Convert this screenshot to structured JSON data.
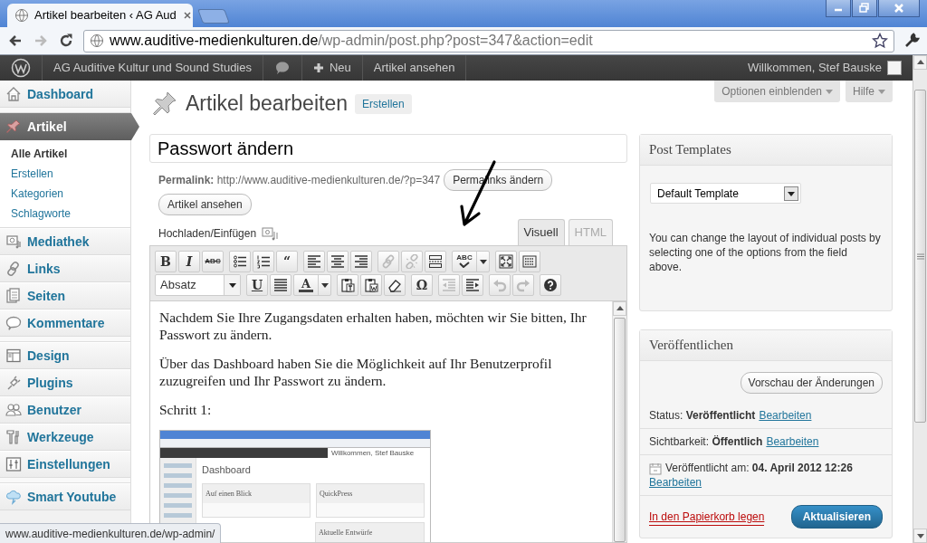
{
  "browser": {
    "tab_title": "Artikel bearbeiten ‹ AG Aud",
    "url_host": "www.auditive-medienkulturen.de",
    "url_path": "/wp-admin/post.php?post=347&action=edit"
  },
  "admin_bar": {
    "site_name": "AG Auditive Kultur und Sound Studies",
    "new_label": "Neu",
    "view_label": "Artikel ansehen",
    "greeting": "Willkommen, Stef Bauske"
  },
  "sidebar": {
    "items": [
      {
        "label": "Dashboard",
        "selected": false,
        "separator_before": false
      },
      {
        "label": "Artikel",
        "selected": true,
        "separator_before": true,
        "children": [
          {
            "label": "Alle Artikel",
            "selected": true
          },
          {
            "label": "Erstellen",
            "selected": false
          },
          {
            "label": "Kategorien",
            "selected": false
          },
          {
            "label": "Schlagworte",
            "selected": false
          }
        ]
      },
      {
        "label": "Mediathek",
        "selected": false,
        "separator_before": false
      },
      {
        "label": "Links",
        "selected": false,
        "separator_before": false
      },
      {
        "label": "Seiten",
        "selected": false,
        "separator_before": false
      },
      {
        "label": "Kommentare",
        "selected": false,
        "separator_before": false
      },
      {
        "label": "Design",
        "selected": false,
        "separator_before": true
      },
      {
        "label": "Plugins",
        "selected": false,
        "separator_before": false
      },
      {
        "label": "Benutzer",
        "selected": false,
        "separator_before": false
      },
      {
        "label": "Werkzeuge",
        "selected": false,
        "separator_before": false
      },
      {
        "label": "Einstellungen",
        "selected": false,
        "separator_before": false
      },
      {
        "label": "Smart Youtube",
        "selected": false,
        "separator_before": true
      }
    ]
  },
  "screen_tabs": [
    "Optionen einblenden",
    "Hilfe"
  ],
  "page": {
    "title": "Artikel bearbeiten",
    "add_new": "Erstellen"
  },
  "post": {
    "title": "Passwort ändern",
    "permalink_label": "Permalink:",
    "permalink_url": "http://www.auditive-medienkulturen.de/?p=347",
    "permalink_buttons": [
      "Permalinks ändern",
      "Artikel ansehen"
    ],
    "upload_label": "Hochladen/Einfügen",
    "editor_tabs": [
      {
        "label": "Visuell",
        "selected": true
      },
      {
        "label": "HTML",
        "selected": false
      }
    ],
    "toolbar": {
      "rows": [
        [
          [
            {
              "kind": "glyph",
              "text": "B",
              "disabled": false
            },
            {
              "kind": "glyph",
              "text": "I",
              "disabled": false
            },
            {
              "kind": "glyph",
              "text": "ABC",
              "disabled": false
            }
          ],
          [
            {
              "kind": "icon",
              "disabled": false
            },
            {
              "kind": "icon",
              "disabled": false
            },
            {
              "kind": "glyph",
              "text": "“",
              "disabled": false
            }
          ],
          [
            {
              "kind": "icon",
              "disabled": false
            },
            {
              "kind": "icon",
              "disabled": false
            },
            {
              "kind": "icon",
              "disabled": false
            }
          ],
          [
            {
              "kind": "icon",
              "disabled": true
            },
            {
              "kind": "icon",
              "disabled": true
            },
            {
              "kind": "icon",
              "disabled": false
            }
          ],
          [
            {
              "kind": "split",
              "text": "ABC",
              "disabled": false
            }
          ],
          [
            {
              "kind": "icon",
              "disabled": false
            },
            {
              "kind": "icon",
              "disabled": false
            }
          ]
        ],
        [
          [
            {
              "kind": "select",
              "text": "Absatz",
              "disabled": false
            }
          ],
          [
            {
              "kind": "glyph",
              "text": "U",
              "disabled": false
            },
            {
              "kind": "icon",
              "disabled": false
            },
            {
              "kind": "split",
              "text": "A",
              "disabled": false
            }
          ],
          [
            {
              "kind": "icon",
              "disabled": false
            },
            {
              "kind": "icon",
              "disabled": false
            },
            {
              "kind": "icon",
              "disabled": false
            }
          ],
          [
            {
              "kind": "glyph",
              "text": "Ω",
              "disabled": false
            }
          ],
          [
            {
              "kind": "icon",
              "disabled": true
            },
            {
              "kind": "icon",
              "disabled": false
            }
          ],
          [
            {
              "kind": "icon",
              "disabled": true
            },
            {
              "kind": "icon",
              "disabled": true
            }
          ],
          [
            {
              "kind": "icon",
              "disabled": false
            }
          ]
        ]
      ]
    },
    "content": {
      "paragraphs": [
        "Nachdem Sie Ihre Zugangsdaten erhalten haben, möchten wir Sie bitten, Ihr Passwort zu ändern.",
        "Über das Dashboard haben Sie die Möglichkeit auf Ihr Benutzerprofil zuzugreifen und Ihr Passwort zu ändern.",
        "Schritt 1:"
      ],
      "image": {
        "greeting": "Willkommen, Stef Bauske",
        "heading": "Dashboard",
        "panels": [
          "Auf einen Blick",
          "QuickPress",
          "Aktuelle Entwürfe"
        ]
      }
    }
  },
  "post_templates": {
    "title": "Post Templates",
    "select_value": "Default Template",
    "help": "You can change the layout of individual posts by selecting one of the options from the field above."
  },
  "publish": {
    "title": "Veröffentlichen",
    "preview": "Vorschau der Änderungen",
    "rows": [
      {
        "kind": "plain",
        "text": "Status: **Veröffentlicht**",
        "link": "Bearbeiten"
      },
      {
        "kind": "plain",
        "text": "Sichtbarkeit: **Öffentlich**",
        "link": "Bearbeiten"
      },
      {
        "kind": "date",
        "text": "Veröffentlicht am: **04. April 2012 12:26**",
        "link": "Bearbeiten"
      }
    ],
    "trash": "In den Papierkorb legen",
    "update": "Aktualisieren"
  },
  "status_bar": "www.auditive-medienkulturen.de/wp-admin/"
}
